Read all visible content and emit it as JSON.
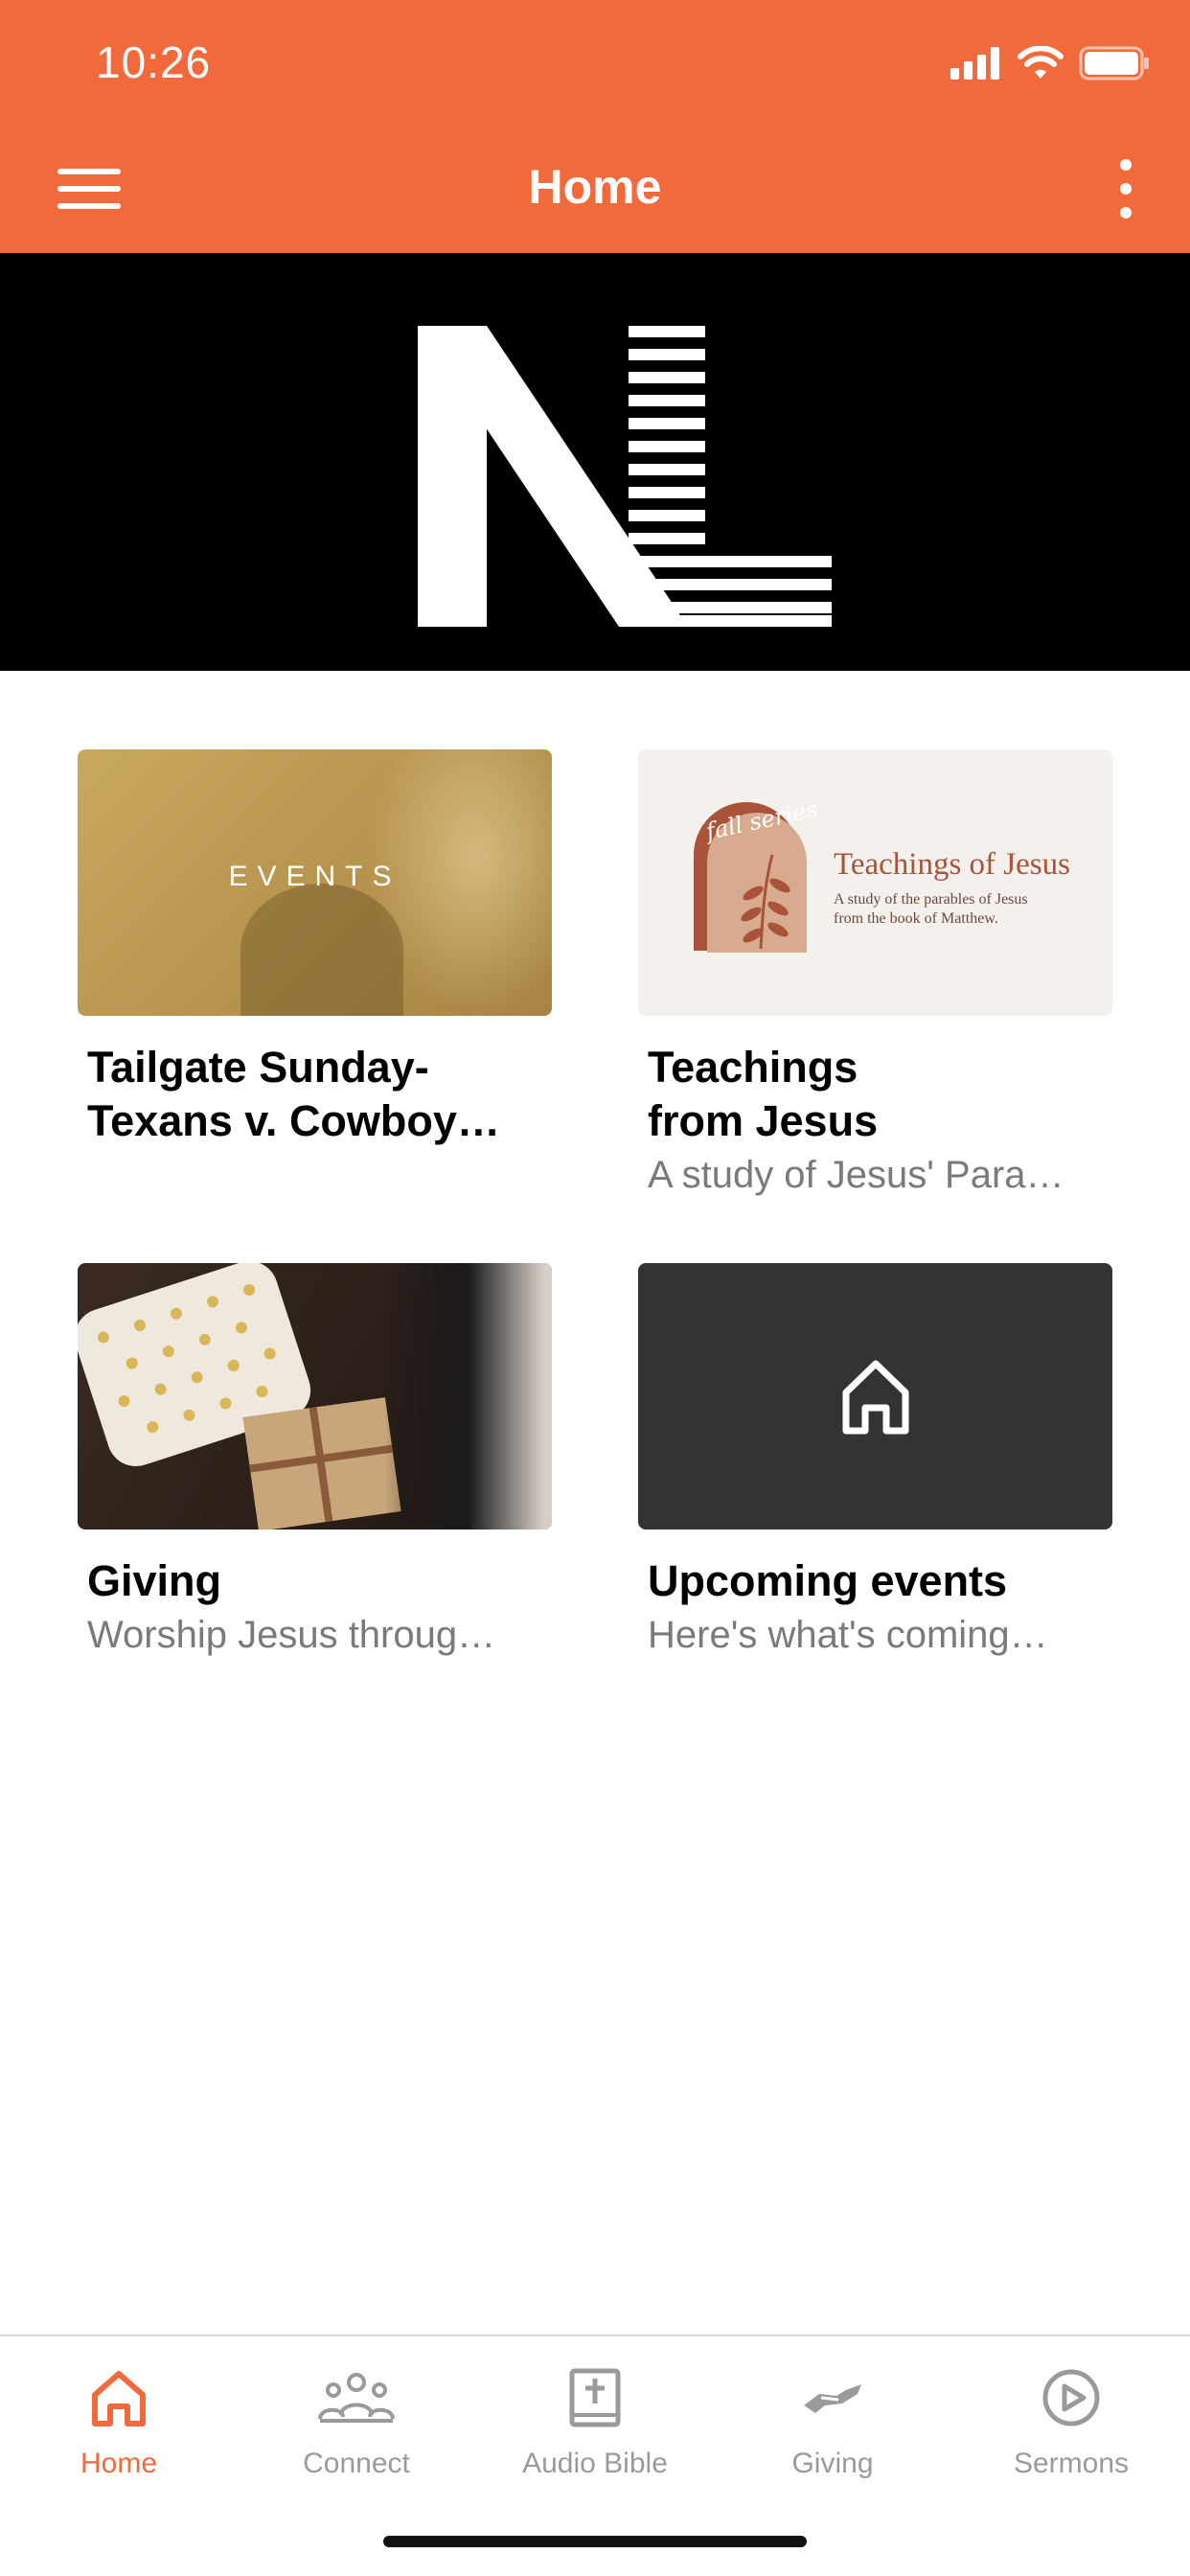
{
  "status_bar": {
    "time": "10:26"
  },
  "nav": {
    "title": "Home"
  },
  "cards": [
    {
      "title": "Tailgate Sunday-\nTexans v. Cowboy…",
      "subtitle": "",
      "thumb_text": "EVENTS"
    },
    {
      "title": "Teachings\nfrom Jesus",
      "subtitle": "A study of Jesus' Para…",
      "thumb": {
        "tag": "fall series",
        "heading": "Teachings of Jesus",
        "line1": "A study of the parables of Jesus",
        "line2": "from the book of Matthew."
      }
    },
    {
      "title": "Giving",
      "subtitle": "Worship Jesus throug…"
    },
    {
      "title": "Upcoming events",
      "subtitle": "Here's what's coming…",
      "thumb_icon": "house-icon"
    }
  ],
  "tabs": [
    {
      "label": "Home",
      "icon": "house-icon",
      "active": true
    },
    {
      "label": "Connect",
      "icon": "people-group-icon",
      "active": false
    },
    {
      "label": "Audio Bible",
      "icon": "bible-cross-icon",
      "active": false
    },
    {
      "label": "Giving",
      "icon": "giving-hand-icon",
      "active": false
    },
    {
      "label": "Sermons",
      "icon": "play-circle-icon",
      "active": false
    }
  ],
  "colors": {
    "accent": "#F26A3B",
    "hero_bg": "#000000",
    "tab_inactive": "#9a9a9a"
  }
}
